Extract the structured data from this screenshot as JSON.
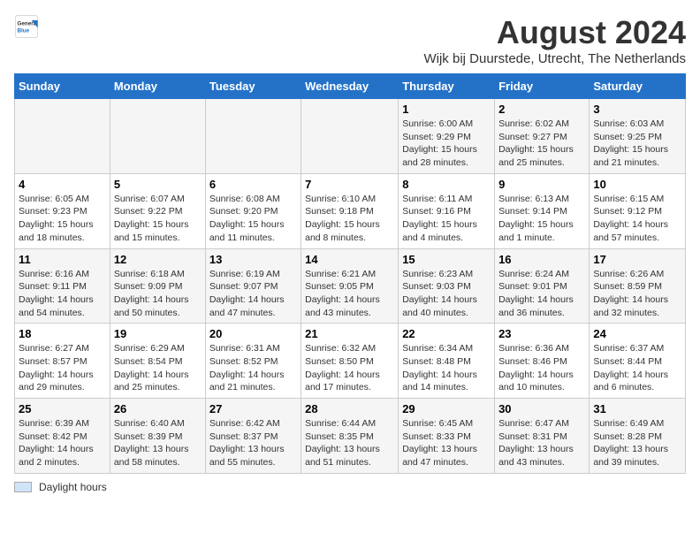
{
  "header": {
    "logo_line1": "General",
    "logo_line2": "Blue",
    "month_year": "August 2024",
    "location": "Wijk bij Duurstede, Utrecht, The Netherlands"
  },
  "days_of_week": [
    "Sunday",
    "Monday",
    "Tuesday",
    "Wednesday",
    "Thursday",
    "Friday",
    "Saturday"
  ],
  "legend_label": "Daylight hours",
  "weeks": [
    [
      {
        "day": "",
        "info": ""
      },
      {
        "day": "",
        "info": ""
      },
      {
        "day": "",
        "info": ""
      },
      {
        "day": "",
        "info": ""
      },
      {
        "day": "1",
        "info": "Sunrise: 6:00 AM\nSunset: 9:29 PM\nDaylight: 15 hours\nand 28 minutes."
      },
      {
        "day": "2",
        "info": "Sunrise: 6:02 AM\nSunset: 9:27 PM\nDaylight: 15 hours\nand 25 minutes."
      },
      {
        "day": "3",
        "info": "Sunrise: 6:03 AM\nSunset: 9:25 PM\nDaylight: 15 hours\nand 21 minutes."
      }
    ],
    [
      {
        "day": "4",
        "info": "Sunrise: 6:05 AM\nSunset: 9:23 PM\nDaylight: 15 hours\nand 18 minutes."
      },
      {
        "day": "5",
        "info": "Sunrise: 6:07 AM\nSunset: 9:22 PM\nDaylight: 15 hours\nand 15 minutes."
      },
      {
        "day": "6",
        "info": "Sunrise: 6:08 AM\nSunset: 9:20 PM\nDaylight: 15 hours\nand 11 minutes."
      },
      {
        "day": "7",
        "info": "Sunrise: 6:10 AM\nSunset: 9:18 PM\nDaylight: 15 hours\nand 8 minutes."
      },
      {
        "day": "8",
        "info": "Sunrise: 6:11 AM\nSunset: 9:16 PM\nDaylight: 15 hours\nand 4 minutes."
      },
      {
        "day": "9",
        "info": "Sunrise: 6:13 AM\nSunset: 9:14 PM\nDaylight: 15 hours\nand 1 minute."
      },
      {
        "day": "10",
        "info": "Sunrise: 6:15 AM\nSunset: 9:12 PM\nDaylight: 14 hours\nand 57 minutes."
      }
    ],
    [
      {
        "day": "11",
        "info": "Sunrise: 6:16 AM\nSunset: 9:11 PM\nDaylight: 14 hours\nand 54 minutes."
      },
      {
        "day": "12",
        "info": "Sunrise: 6:18 AM\nSunset: 9:09 PM\nDaylight: 14 hours\nand 50 minutes."
      },
      {
        "day": "13",
        "info": "Sunrise: 6:19 AM\nSunset: 9:07 PM\nDaylight: 14 hours\nand 47 minutes."
      },
      {
        "day": "14",
        "info": "Sunrise: 6:21 AM\nSunset: 9:05 PM\nDaylight: 14 hours\nand 43 minutes."
      },
      {
        "day": "15",
        "info": "Sunrise: 6:23 AM\nSunset: 9:03 PM\nDaylight: 14 hours\nand 40 minutes."
      },
      {
        "day": "16",
        "info": "Sunrise: 6:24 AM\nSunset: 9:01 PM\nDaylight: 14 hours\nand 36 minutes."
      },
      {
        "day": "17",
        "info": "Sunrise: 6:26 AM\nSunset: 8:59 PM\nDaylight: 14 hours\nand 32 minutes."
      }
    ],
    [
      {
        "day": "18",
        "info": "Sunrise: 6:27 AM\nSunset: 8:57 PM\nDaylight: 14 hours\nand 29 minutes."
      },
      {
        "day": "19",
        "info": "Sunrise: 6:29 AM\nSunset: 8:54 PM\nDaylight: 14 hours\nand 25 minutes."
      },
      {
        "day": "20",
        "info": "Sunrise: 6:31 AM\nSunset: 8:52 PM\nDaylight: 14 hours\nand 21 minutes."
      },
      {
        "day": "21",
        "info": "Sunrise: 6:32 AM\nSunset: 8:50 PM\nDaylight: 14 hours\nand 17 minutes."
      },
      {
        "day": "22",
        "info": "Sunrise: 6:34 AM\nSunset: 8:48 PM\nDaylight: 14 hours\nand 14 minutes."
      },
      {
        "day": "23",
        "info": "Sunrise: 6:36 AM\nSunset: 8:46 PM\nDaylight: 14 hours\nand 10 minutes."
      },
      {
        "day": "24",
        "info": "Sunrise: 6:37 AM\nSunset: 8:44 PM\nDaylight: 14 hours\nand 6 minutes."
      }
    ],
    [
      {
        "day": "25",
        "info": "Sunrise: 6:39 AM\nSunset: 8:42 PM\nDaylight: 14 hours\nand 2 minutes."
      },
      {
        "day": "26",
        "info": "Sunrise: 6:40 AM\nSunset: 8:39 PM\nDaylight: 13 hours\nand 58 minutes."
      },
      {
        "day": "27",
        "info": "Sunrise: 6:42 AM\nSunset: 8:37 PM\nDaylight: 13 hours\nand 55 minutes."
      },
      {
        "day": "28",
        "info": "Sunrise: 6:44 AM\nSunset: 8:35 PM\nDaylight: 13 hours\nand 51 minutes."
      },
      {
        "day": "29",
        "info": "Sunrise: 6:45 AM\nSunset: 8:33 PM\nDaylight: 13 hours\nand 47 minutes."
      },
      {
        "day": "30",
        "info": "Sunrise: 6:47 AM\nSunset: 8:31 PM\nDaylight: 13 hours\nand 43 minutes."
      },
      {
        "day": "31",
        "info": "Sunrise: 6:49 AM\nSunset: 8:28 PM\nDaylight: 13 hours\nand 39 minutes."
      }
    ]
  ]
}
